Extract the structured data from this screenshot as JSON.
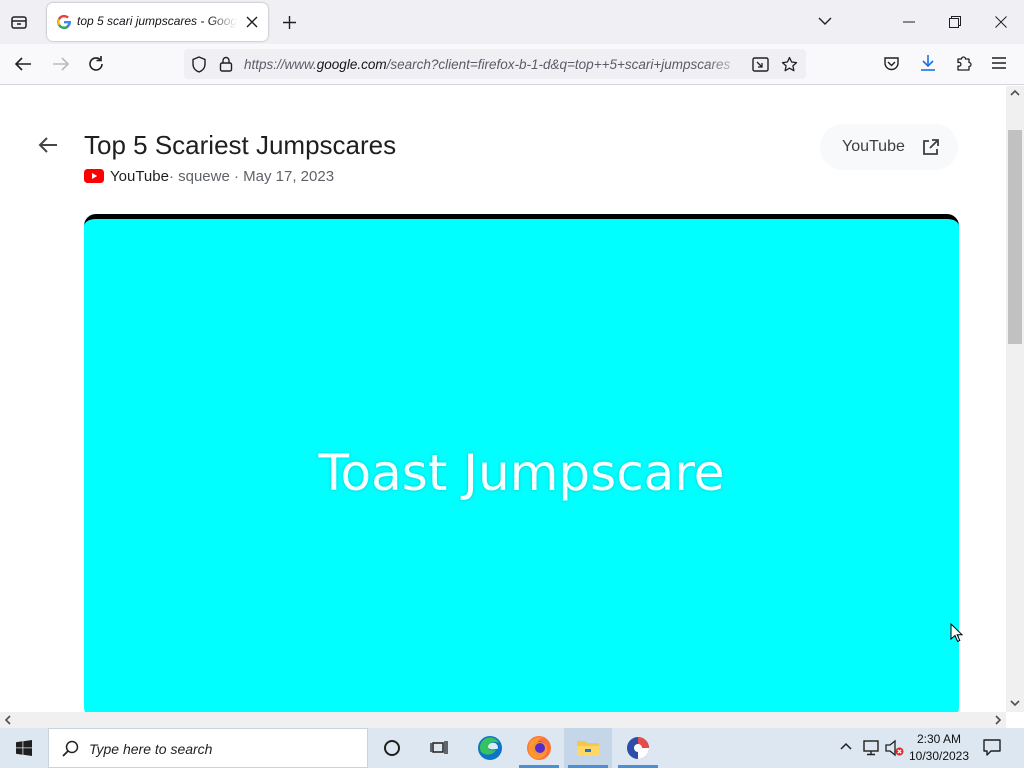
{
  "browser": {
    "tab": {
      "title": "top 5 scari jumpscares - Google Search",
      "favicon": "google-g-icon"
    },
    "url": {
      "scheme": "https://www.",
      "host": "google.com",
      "path": "/search?client=firefox-b-1-d&q=top++5+scari+jumpscares"
    }
  },
  "page": {
    "title": "Top 5 Scariest Jumpscares",
    "meta": {
      "source": "YouTube",
      "rest": " · squewe · May 17, 2023"
    },
    "external_button_label": "YouTube",
    "video_text": "Toast Jumpscare",
    "video_bg_color": "#00ffff"
  },
  "taskbar": {
    "search_placeholder": "Type here to search",
    "time": "2:30 AM",
    "date": "10/30/2023",
    "accent_color": "#4c8fd6"
  }
}
